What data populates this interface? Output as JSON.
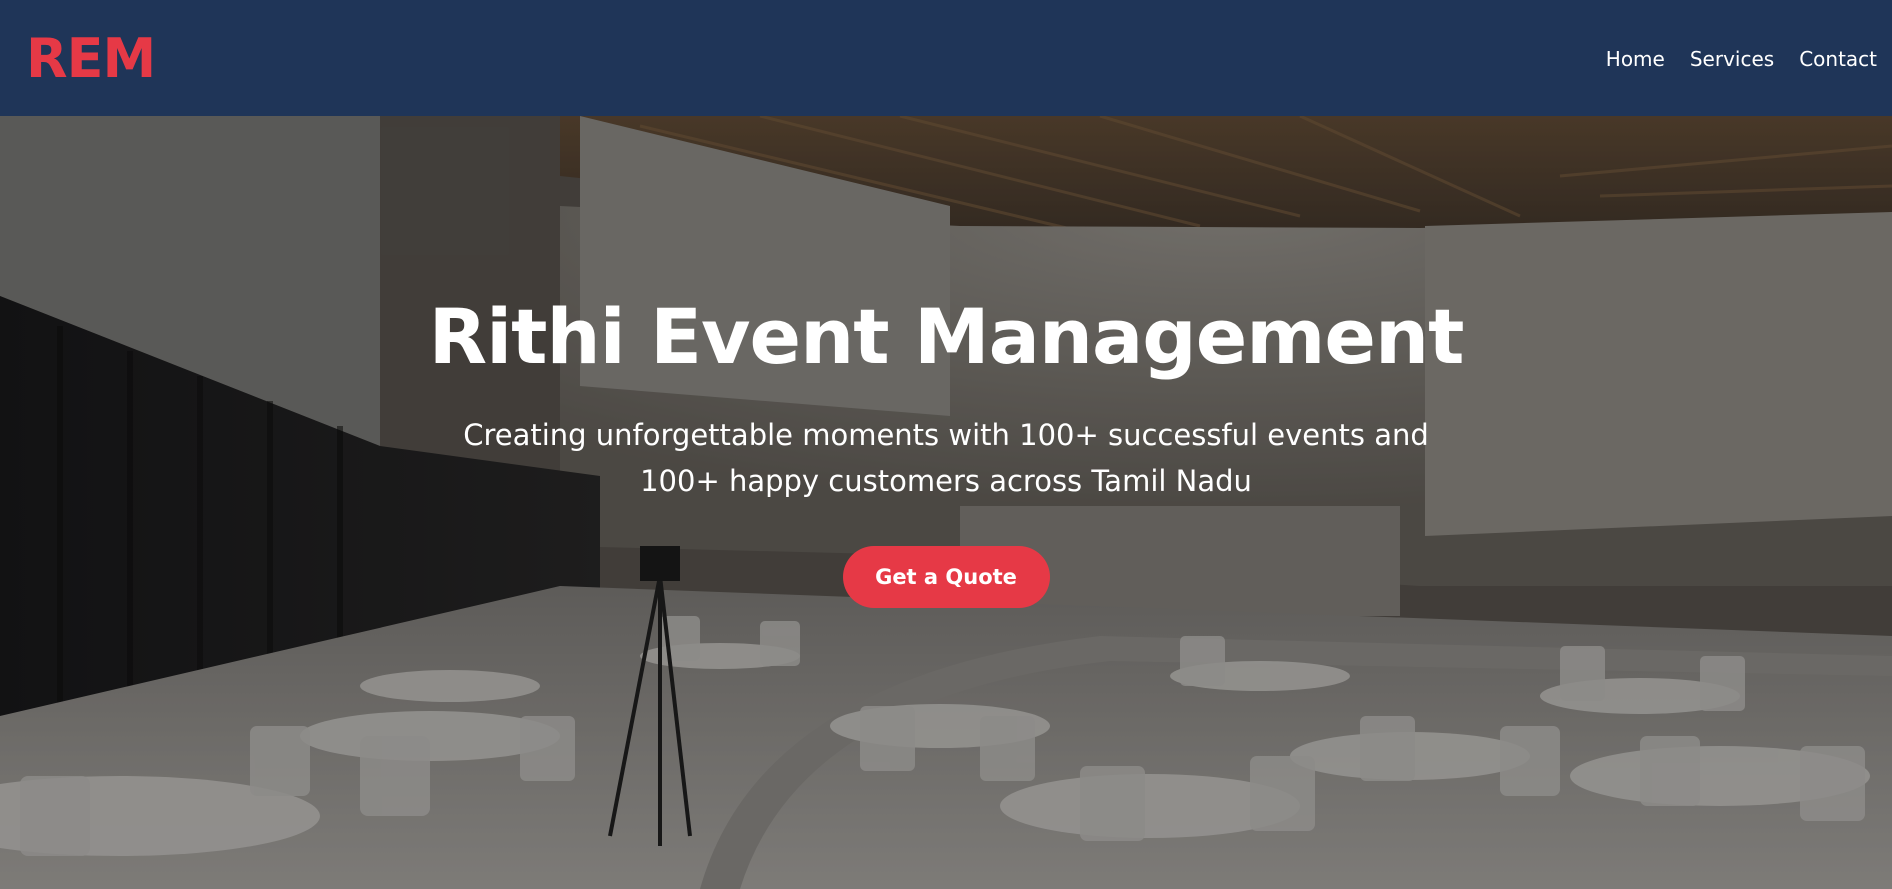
{
  "brand": {
    "logo_text": "REM",
    "accent_color": "#e63946",
    "nav_bg_color": "#1f3558"
  },
  "nav": {
    "items": [
      {
        "label": "Home"
      },
      {
        "label": "Services"
      },
      {
        "label": "Contact"
      }
    ]
  },
  "hero": {
    "title": "Rithi Event Management",
    "subtitle": "Creating unforgettable moments with 100+ successful events and 100+ happy customers across Tamil Nadu",
    "cta_label": "Get a Quote"
  }
}
